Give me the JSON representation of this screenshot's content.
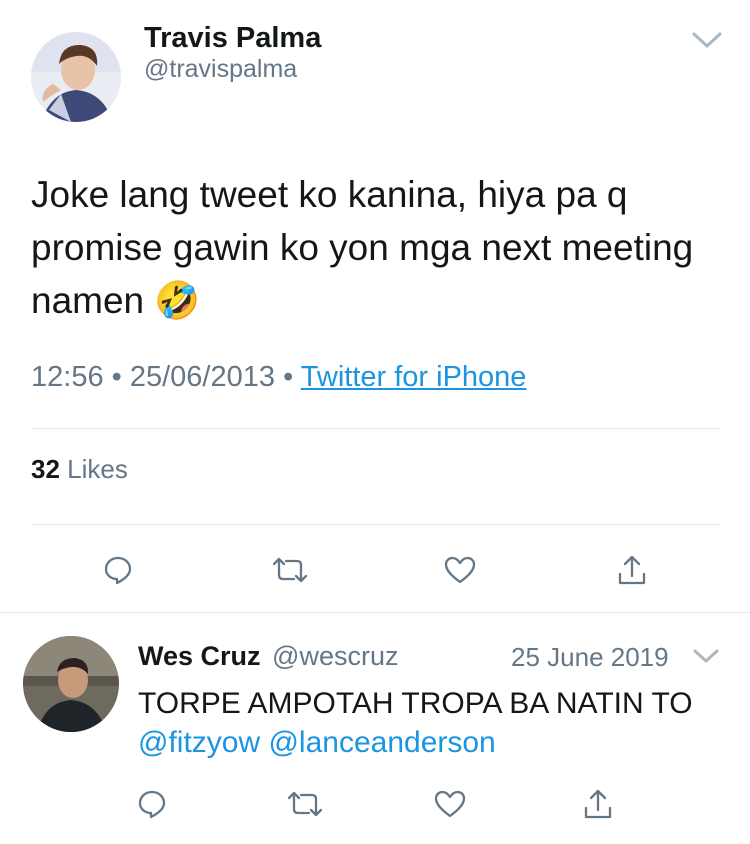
{
  "tweet": {
    "author_name": "Travis Palma",
    "author_handle": "@travispalma",
    "text": "Joke lang tweet ko kanina, hiya pa q promise gawin ko yon mga next meeting namen",
    "emoji": "🤣",
    "time": "12:56",
    "date": "25/06/2013",
    "separator": "•",
    "source": "Twitter for iPhone",
    "likes_count": "32",
    "likes_label": "Likes"
  },
  "reply": {
    "author_name": "Wes Cruz",
    "author_handle": "@wescruz",
    "date": "25 June 2019",
    "text": "TORPE AMPOTAH TROPA BA NATIN TO",
    "mentions": "@fitzyow @lanceanderson"
  },
  "icons": {
    "reply": "reply-icon",
    "retweet": "retweet-icon",
    "like": "heart-icon",
    "share": "share-icon",
    "menu": "chevron-down-icon"
  },
  "colors": {
    "link": "#1b95e0",
    "secondary_text": "#657786",
    "divider": "#e1e8ed",
    "icon": "#657786"
  }
}
